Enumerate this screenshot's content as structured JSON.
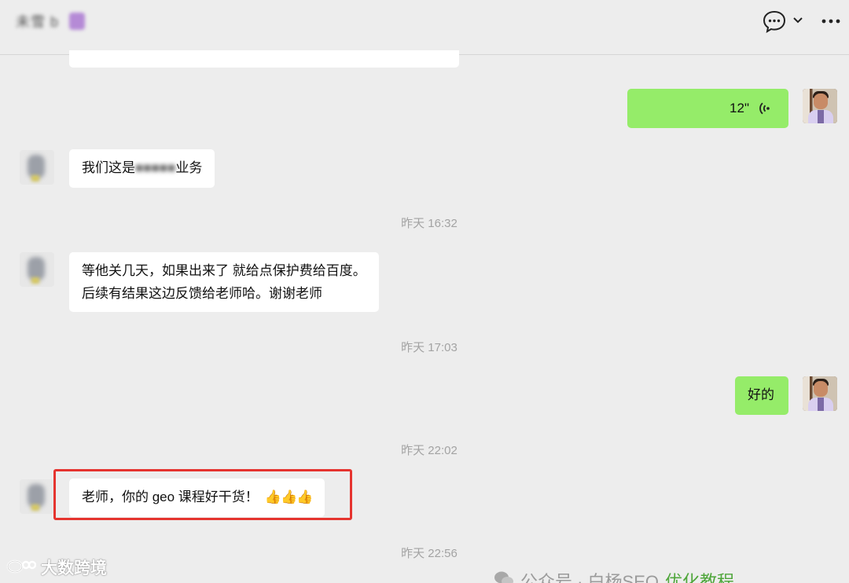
{
  "header": {
    "title": "未雪 b",
    "icons": [
      "chat-bubble-icon",
      "chevron-down-icon",
      "more-icon"
    ]
  },
  "messages": [
    {
      "side": "me",
      "type": "voice",
      "text": "12\""
    },
    {
      "side": "them",
      "type": "text",
      "prefix": "我们这是",
      "blurred": "■■■■■",
      "suffix": "业务"
    },
    {
      "side": "time",
      "text": "昨天 16:32"
    },
    {
      "side": "them",
      "type": "text",
      "lines": [
        "等他关几天，如果出来了 就给点保护费给百度。",
        "后续有结果这边反馈给老师哈。谢谢老师"
      ]
    },
    {
      "side": "time",
      "text": "昨天 17:03"
    },
    {
      "side": "me",
      "type": "text",
      "text": "好的"
    },
    {
      "side": "time",
      "text": "昨天 22:02"
    },
    {
      "side": "them",
      "type": "text",
      "text": "老师，你的 geo 课程好干货！",
      "emoji": "👍👍👍",
      "highlighted": true
    },
    {
      "side": "time",
      "text": "昨天 22:56"
    }
  ],
  "watermarks": {
    "left": "大数跨境",
    "right_prefix": "公众号 · 白杨SEO",
    "right_highlight": "优化教程"
  },
  "colors": {
    "self_bubble": "#95ec69",
    "other_bubble": "#ffffff",
    "highlight_border": "#e5342f",
    "background": "#ededed"
  }
}
